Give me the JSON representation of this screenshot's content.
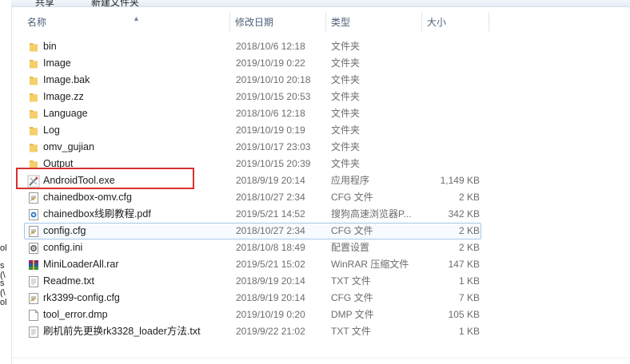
{
  "toolbar": {
    "share_label": "共享",
    "new_folder_label": "新建文件夹"
  },
  "header": {
    "name": "名称",
    "date": "修改日期",
    "type": "类型",
    "size": "大小"
  },
  "left_fragments": [
    "ol",
    "s (\\",
    "s (\\",
    "ol"
  ],
  "files": [
    {
      "name": "bin",
      "date": "2018/10/6 12:18",
      "type": "文件夹",
      "size": "",
      "icon": "folder-icon"
    },
    {
      "name": "Image",
      "date": "2019/10/19 0:22",
      "type": "文件夹",
      "size": "",
      "icon": "folder-icon"
    },
    {
      "name": "Image.bak",
      "date": "2019/10/10 20:18",
      "type": "文件夹",
      "size": "",
      "icon": "folder-icon"
    },
    {
      "name": "Image.zz",
      "date": "2019/10/15 20:53",
      "type": "文件夹",
      "size": "",
      "icon": "folder-icon"
    },
    {
      "name": "Language",
      "date": "2018/10/6 12:18",
      "type": "文件夹",
      "size": "",
      "icon": "folder-icon"
    },
    {
      "name": "Log",
      "date": "2019/10/19 0:19",
      "type": "文件夹",
      "size": "",
      "icon": "folder-icon"
    },
    {
      "name": "omv_gujian",
      "date": "2019/10/17 23:03",
      "type": "文件夹",
      "size": "",
      "icon": "folder-icon"
    },
    {
      "name": "Output",
      "date": "2019/10/15 20:39",
      "type": "文件夹",
      "size": "",
      "icon": "folder-icon"
    },
    {
      "name": "AndroidTool.exe",
      "date": "2018/9/19 20:14",
      "type": "应用程序",
      "size": "1,149 KB",
      "icon": "exe-tool-icon"
    },
    {
      "name": "chainedbox-omv.cfg",
      "date": "2018/10/27 2:34",
      "type": "CFG 文件",
      "size": "2 KB",
      "icon": "cfg-file-icon"
    },
    {
      "name": "chainedbox线刷教程.pdf",
      "date": "2019/5/21 14:52",
      "type": "搜狗高速浏览器P...",
      "size": "342 KB",
      "icon": "pdf-file-icon"
    },
    {
      "name": "config.cfg",
      "date": "2018/10/27 2:34",
      "type": "CFG 文件",
      "size": "2 KB",
      "icon": "cfg-file-icon"
    },
    {
      "name": "config.ini",
      "date": "2018/10/8 18:49",
      "type": "配置设置",
      "size": "2 KB",
      "icon": "ini-file-icon"
    },
    {
      "name": "MiniLoaderAll.rar",
      "date": "2019/5/21 15:02",
      "type": "WinRAR 压缩文件",
      "size": "147 KB",
      "icon": "rar-file-icon"
    },
    {
      "name": "Readme.txt",
      "date": "2018/9/19 20:14",
      "type": "TXT 文件",
      "size": "1 KB",
      "icon": "txt-file-icon"
    },
    {
      "name": "rk3399-config.cfg",
      "date": "2018/9/19 20:14",
      "type": "CFG 文件",
      "size": "7 KB",
      "icon": "cfg-file-icon"
    },
    {
      "name": "tool_error.dmp",
      "date": "2019/10/19 0:20",
      "type": "DMP 文件",
      "size": "105 KB",
      "icon": "file-icon"
    },
    {
      "name": "刷机前先更换rk3328_loader方法.txt",
      "date": "2019/9/22 21:02",
      "type": "TXT 文件",
      "size": "1 KB",
      "icon": "txt-file-icon"
    }
  ],
  "colors": {
    "selection_border": "#a8c8ea",
    "highlight_box": "#d9302f",
    "folder": "#e8b948",
    "header_text": "#4c607a"
  }
}
